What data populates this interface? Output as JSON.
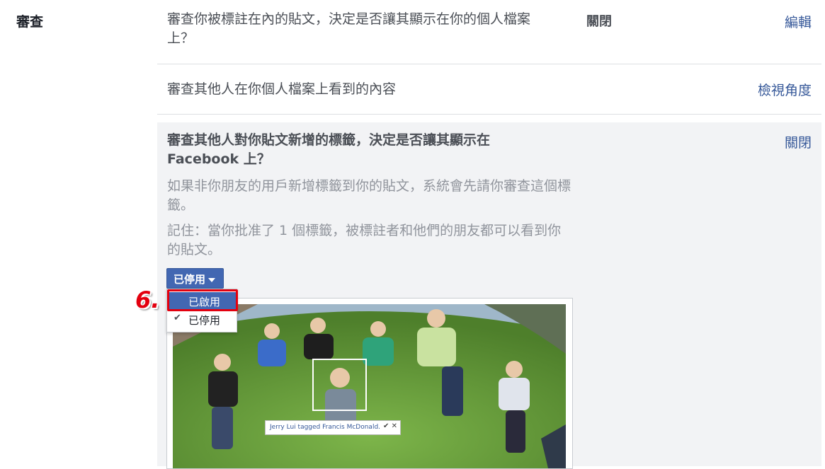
{
  "section": {
    "label": "審查"
  },
  "rows": [
    {
      "description": "審查你被標註在內的貼文，決定是否讓其顯示在你的個人檔案上？",
      "state": "關閉",
      "action": "編輯"
    },
    {
      "description": "審查其他人在你個人檔案上看到的內容",
      "action": "檢視角度"
    }
  ],
  "expanded": {
    "title": "審查其他人對你貼文新增的標籤，決定是否讓其顯示在 Facebook 上？",
    "paragraph1": "如果非你朋友的用戶新增標籤到你的貼文，系統會先請你審查這個標籤。",
    "paragraph2": "記住：當你批准了 1 個標籤，被標註者和他們的朋友都可以看到你的貼文。",
    "close": "關閉",
    "dropdown_value": "已停用",
    "menu": [
      {
        "label": "已啟用",
        "highlighted": true
      },
      {
        "label": "已停用",
        "checked": true
      }
    ],
    "check_mark": "✔",
    "photo_caption": {
      "tagger": "Jerry Lui tagged",
      "tagged": "Francis McDonald.",
      "approve": "✔",
      "reject": "✕"
    }
  },
  "annotation": {
    "step": "6."
  },
  "colors": {
    "accent": "#4267b2",
    "link": "#365899",
    "highlight": "#e3000f",
    "panel": "#f2f3f5"
  }
}
